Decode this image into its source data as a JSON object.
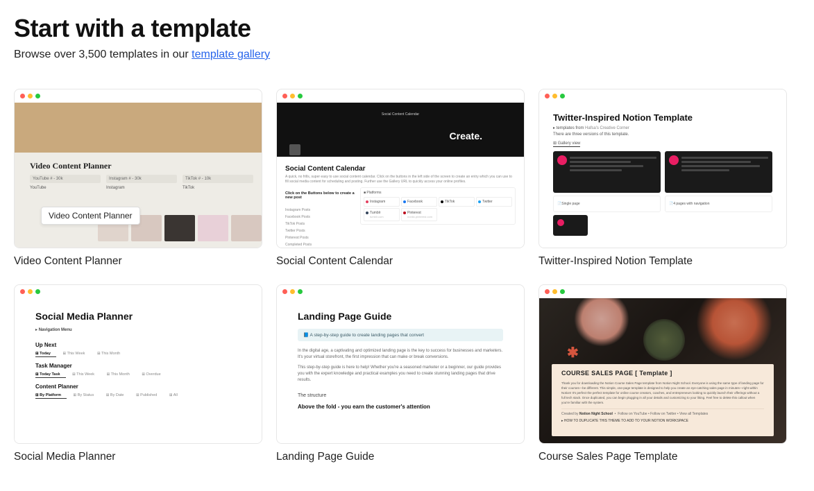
{
  "heading": "Start with a template",
  "subtitle_prefix": "Browse over 3,500 templates in our ",
  "subtitle_link": "template gallery",
  "templates": [
    {
      "title": "Video Content Planner",
      "preview": {
        "heading": "Video Content Planner",
        "col1": "YouTube # - 30k",
        "col2": "Instagram # - 30k",
        "col3": "TikTok # - 10k",
        "sub1": "YouTube",
        "sub2": "Instagram",
        "sub3": "TikTok",
        "tooltip": "Video Content Planner"
      }
    },
    {
      "title": "Social Content Calendar",
      "preview": {
        "hero_sub": "Social Content Calendar",
        "hero_text": "Create.",
        "heading": "Social Content Calendar",
        "desc": "A quick, no frills, super easy to use social content calendar. Click on the buttons in the left side of the screen to create an entry which you can use to fill social media content for scheduling and posting. Further use the Gallery URL to quickly access your online profiles.",
        "click_label": "Click on the Buttons below to create a new post",
        "platforms_label": "Platforms",
        "left_items": [
          "Instagram Posts",
          "Facebook Posts",
          "TikTok Posts",
          "Twitter Posts",
          "Pinterest Posts",
          "Completed Posts"
        ],
        "cells": [
          {
            "name": "Instagram",
            "color": "#e4405f"
          },
          {
            "name": "Facebook",
            "color": "#1877f2"
          },
          {
            "name": "TikTok",
            "color": "#000"
          },
          {
            "name": "Twitter",
            "color": "#1da1f2"
          },
          {
            "name": "Tumblr",
            "sub": "tumblr.com",
            "color": "#35465c"
          },
          {
            "name": "Pinterest",
            "sub": "nordic.pinterest.com",
            "color": "#bd081c"
          }
        ]
      }
    },
    {
      "title": "Twitter-Inspired Notion Template",
      "preview": {
        "heading": "Twitter-Inspired Notion Template",
        "sub1_prefix": "▸ templates from ",
        "sub1_link": "Hafsa's Creative Corner",
        "sub2": "There are three versions of this template.",
        "tab": "Gallery view",
        "caption1": "Single page",
        "caption2": "4 pages with navigation"
      }
    },
    {
      "title": "Social Media Planner",
      "preview": {
        "heading": "Social Media Planner",
        "nav": "Navigation Menu",
        "sec1": "Up Next",
        "tabs1": [
          "Today",
          "This Week",
          "This Month"
        ],
        "sec2": "Task Manager",
        "tabs2": [
          "Today Task",
          "This Week",
          "This Month",
          "Overdue"
        ],
        "sec3": "Content Planner",
        "tabs3": [
          "By Platform",
          "By Status",
          "By Date",
          "Published",
          "All"
        ]
      }
    },
    {
      "title": "Landing Page Guide",
      "preview": {
        "heading": "Landing Page Guide",
        "callout": "A step-by-step guide to create landing pages that convert",
        "p1": "In the digital age, a captivating and optimized landing page is the key to success for businesses and marketers. It's your virtual storefront, the first impression that can make or break conversions.",
        "p2": "This step-by-step guide is here to help! Whether you're a seasoned marketer or a beginner, our guide provides you with the expert knowledge and practical examples you need to create stunning landing pages that drive results.",
        "h2": "The structure",
        "h3": "Above the fold - you earn the customer's attention"
      }
    },
    {
      "title": "Course Sales Page Template",
      "preview": {
        "heading": "COURSE SALES PAGE [ Template ]",
        "body": "Thank you for downloading the Notion Course Sales Page template from Notion Night School. Everyone is using the same type of landing page for their courses—be different. This simple, one-page template is designed to help you create an eye-catching sales page in minutes—right within Notion! It's perfect the perfect template for online course creators, coaches, and entrepreneurs looking to quickly launch their offerings without a full tech stack. Once duplicated, you can begin plugging in all your details and customizing to your liking. Feel free to delete this callout when you're familiar with the system.",
        "meta_by": "Created by",
        "meta_author": "Notion Night School",
        "meta_links": "Follow on YouTube  •  Follow on Twitter  •  View all Templates",
        "how": "HOW TO DUPLICATE THIS THEME TO ADD TO YOUR NOTION WORKSPACE"
      }
    }
  ]
}
